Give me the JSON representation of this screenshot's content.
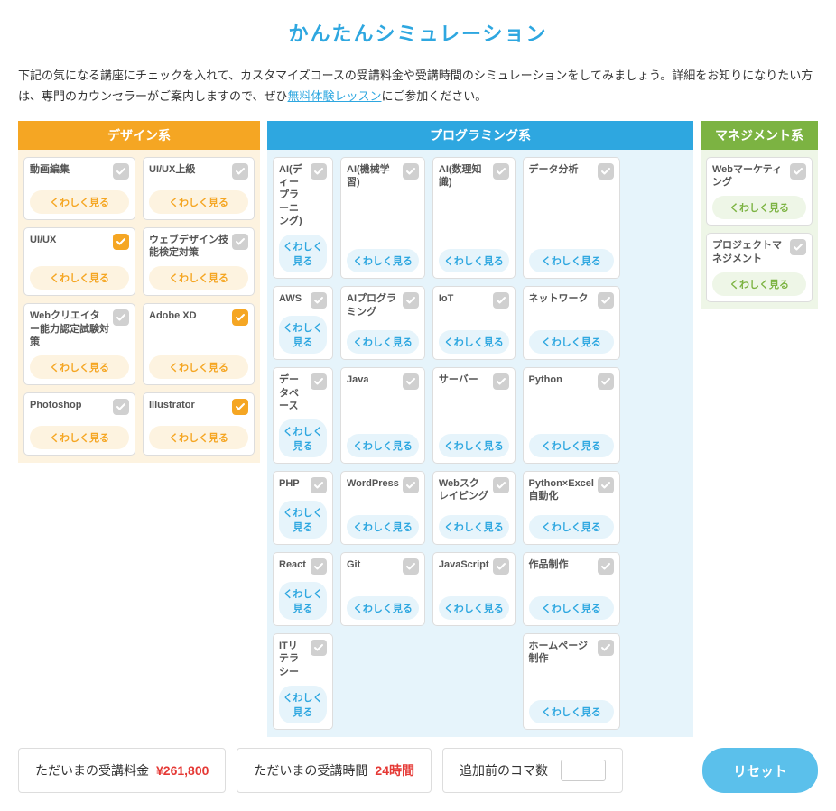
{
  "title": "かんたんシミュレーション",
  "description": {
    "text1": "下記の気になる講座にチェックを入れて、カスタマイズコースの受講料金や受講時間のシミュレーションをしてみましょう。詳細をお知りになりたい方は、専門のカウンセラーがご案内しますので、ぜひ",
    "link": "無料体験レッスン",
    "text2": "にご参加ください。"
  },
  "detail_label": "くわしく見る",
  "categories": {
    "design": {
      "header": "デザイン系",
      "items": [
        {
          "name": "動画編集",
          "checked": false
        },
        {
          "name": "UI/UX上級",
          "checked": false
        },
        {
          "name": "UI/UX",
          "checked": true
        },
        {
          "name": "ウェブデザイン技能検定対策",
          "checked": false
        },
        {
          "name": "Webクリエイター能力認定試験対策",
          "checked": false
        },
        {
          "name": "Adobe XD",
          "checked": true
        },
        {
          "name": "Photoshop",
          "checked": false
        },
        {
          "name": "Illustrator",
          "checked": true
        }
      ]
    },
    "programming": {
      "header": "プログラミング系",
      "items": [
        {
          "name": "AI(ディープラーニング)",
          "checked": false
        },
        {
          "name": "AI(機械学習)",
          "checked": false
        },
        {
          "name": "AI(数理知識)",
          "checked": false
        },
        {
          "name": "データ分析",
          "checked": false
        },
        {
          "name": "",
          "checked": false,
          "empty": true
        },
        {
          "name": "AWS",
          "checked": false
        },
        {
          "name": "AIプログラミング",
          "checked": false
        },
        {
          "name": "IoT",
          "checked": false
        },
        {
          "name": "ネットワーク",
          "checked": false
        },
        {
          "name": "",
          "checked": false,
          "empty": true
        },
        {
          "name": "データベース",
          "checked": false
        },
        {
          "name": "Java",
          "checked": false
        },
        {
          "name": "サーバー",
          "checked": false
        },
        {
          "name": "Python",
          "checked": false
        },
        {
          "name": "",
          "checked": false,
          "empty": true
        },
        {
          "name": "PHP",
          "checked": false
        },
        {
          "name": "WordPress",
          "checked": false
        },
        {
          "name": "Webスクレイピング",
          "checked": false
        },
        {
          "name": "Python×Excel自動化",
          "checked": false
        },
        {
          "name": "",
          "checked": false,
          "empty": true
        },
        {
          "name": "React",
          "checked": false
        },
        {
          "name": "Git",
          "checked": false
        },
        {
          "name": "JavaScript",
          "checked": false
        },
        {
          "name": "作品制作",
          "checked": false
        },
        {
          "name": "",
          "checked": false,
          "empty": true
        },
        {
          "name": "ITリテラシー",
          "checked": false
        },
        {
          "name": "",
          "checked": false,
          "empty": true
        },
        {
          "name": "",
          "checked": false,
          "empty": true
        },
        {
          "name": "ホームページ制作",
          "checked": false
        },
        {
          "name": "",
          "checked": false,
          "empty": true
        }
      ]
    },
    "management": {
      "header": "マネジメント系",
      "items": [
        {
          "name": "Webマーケティング",
          "checked": false
        },
        {
          "name": "プロジェクトマネジメント",
          "checked": false
        }
      ]
    }
  },
  "bottom": {
    "fee_label": "ただいまの受講料金",
    "fee_value": "¥261,800",
    "hours_label": "ただいまの受講時間",
    "hours_value": "24時間",
    "add_slots_label": "追加前のコマ数",
    "add_slots_value": "",
    "reset_label": "リセット"
  }
}
